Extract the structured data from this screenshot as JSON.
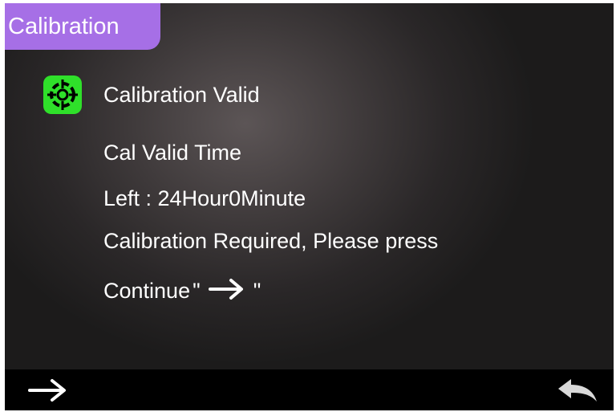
{
  "header": {
    "title": "Calibration"
  },
  "status": {
    "icon": "calibration-target-icon",
    "icon_color": "#2fe02a",
    "text": "Calibration Valid"
  },
  "message": {
    "line1": "Cal Valid Time",
    "line2": "Left : 24Hour0Minute",
    "line3": "Calibration Required, Please press",
    "line4_prefix": "Continue",
    "open_quote": "\"",
    "arrow_icon": "right-arrow-icon",
    "close_quote": "\""
  },
  "bottom_bar": {
    "left_button_icon": "right-arrow-icon",
    "right_button_icon": "return-arrow-icon"
  },
  "colors": {
    "title_tab": "#a66fe6",
    "bottom_bar": "#000000",
    "text": "#ffffff"
  }
}
